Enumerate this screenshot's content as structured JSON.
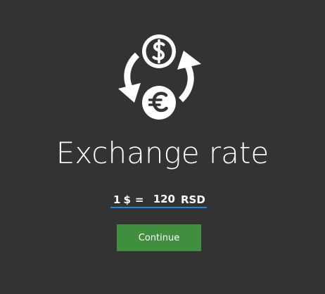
{
  "app": {
    "title": "Exchange rate"
  },
  "rate": {
    "left_amount": "1",
    "left_currency_symbol": "$",
    "equals_sign": "=",
    "value": "120",
    "target_currency": "RSD"
  },
  "actions": {
    "continue_label": "Continue"
  },
  "icons": {
    "hero": "currency-exchange-icon",
    "dollar": "dollar-coin-icon",
    "euro": "euro-coin-icon"
  },
  "colors": {
    "background": "#333333",
    "accent_underline": "#1e88e5",
    "button": "#3f8f3f",
    "text": "#ffffff"
  }
}
